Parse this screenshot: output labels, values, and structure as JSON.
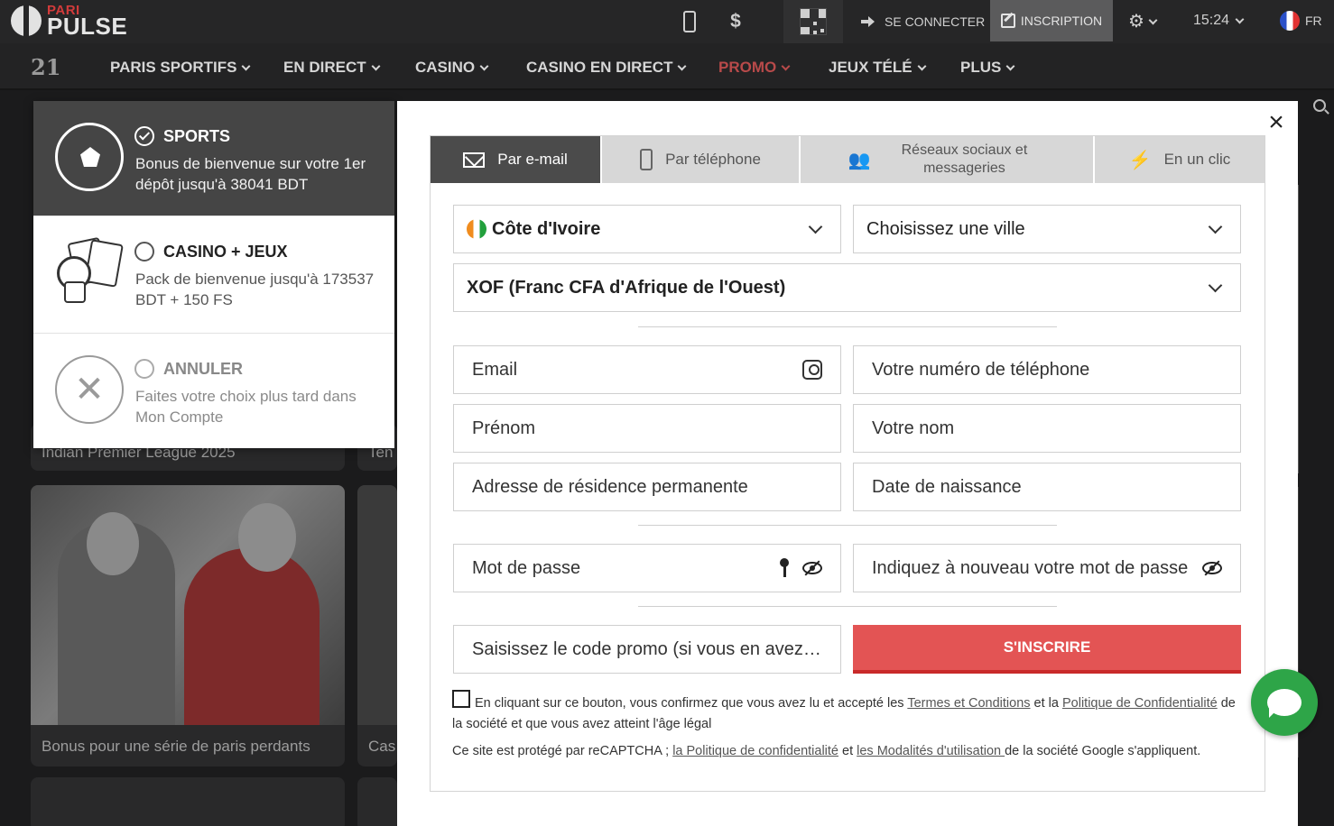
{
  "header": {
    "logo_small": "PARI",
    "logo_big": "PULSE",
    "login_label": "SE CONNECTER",
    "signup_label": "INSCRIPTION",
    "time": "15:24",
    "language": "FR",
    "currency_icon": "$"
  },
  "nav": {
    "logo": "21",
    "items": [
      {
        "label": "PARIS SPORTIFS"
      },
      {
        "label": "EN DIRECT"
      },
      {
        "label": "CASINO"
      },
      {
        "label": "CASINO EN DIRECT"
      },
      {
        "label": "PROMO"
      },
      {
        "label": "JEUX TÉLÉ"
      },
      {
        "label": "PLUS"
      }
    ]
  },
  "background": {
    "card1_caption": "Indian Premier League 2025",
    "card2_caption": "Ten",
    "card3_caption": "Bonus pour une série de paris perdants",
    "card4_caption": "Cas"
  },
  "bonus": {
    "options": [
      {
        "title": "SPORTS",
        "desc": "Bonus de bienvenue sur votre 1er dépôt jusqu'à 38041 BDT",
        "selected": true
      },
      {
        "title": "CASINO + JEUX",
        "desc": "Pack de bienvenue jusqu'à 173537 BDT + 150 FS",
        "selected": false
      },
      {
        "title": "ANNULER",
        "desc": "Faites votre choix plus tard dans Mon Compte",
        "selected": false
      }
    ]
  },
  "modal": {
    "close": "×",
    "tabs": [
      {
        "label": "Par e-mail"
      },
      {
        "label": "Par téléphone"
      },
      {
        "label": "Réseaux sociaux et messageries"
      },
      {
        "label": "En un clic"
      }
    ],
    "country": "Côte d'Ivoire",
    "city_placeholder": "Choisissez une ville",
    "currency": "XOF (Franc CFA d'Afrique de l'Ouest)",
    "email_placeholder": "Email",
    "phone_placeholder": "Votre numéro de téléphone",
    "firstname_placeholder": "Prénom",
    "lastname_placeholder": "Votre nom",
    "address_placeholder": "Adresse de résidence permanente",
    "birthdate_placeholder": "Date de naissance",
    "password_placeholder": "Mot de passe",
    "password_repeat_placeholder": "Indiquez à nouveau votre mot de passe",
    "promo_placeholder": "Saisissez le code promo (si vous en avez u...",
    "submit_label": "S'INSCRIRE",
    "legal": {
      "part1": "En cliquant sur ce bouton, vous confirmez que vous avez lu et accepté les ",
      "terms_link": "Termes et Conditions",
      "part2": " et la ",
      "privacy_link": "Politique de Confidentialité",
      "part3": " de la société et que vous avez atteint l'âge légal"
    },
    "captcha": {
      "part1": "Ce site est protégé par reCAPTCHA ; ",
      "policy_link": "la Politique de confidentialité",
      "part2": " et ",
      "terms_link": "les Modalités d'utilisation ",
      "part3": "de la société Google s'appliquent."
    }
  },
  "colors": {
    "submit": "#e35454",
    "promo_nav": "#b84a4a",
    "chat": "#2ea548",
    "active_tab": "#4b4b4b"
  }
}
